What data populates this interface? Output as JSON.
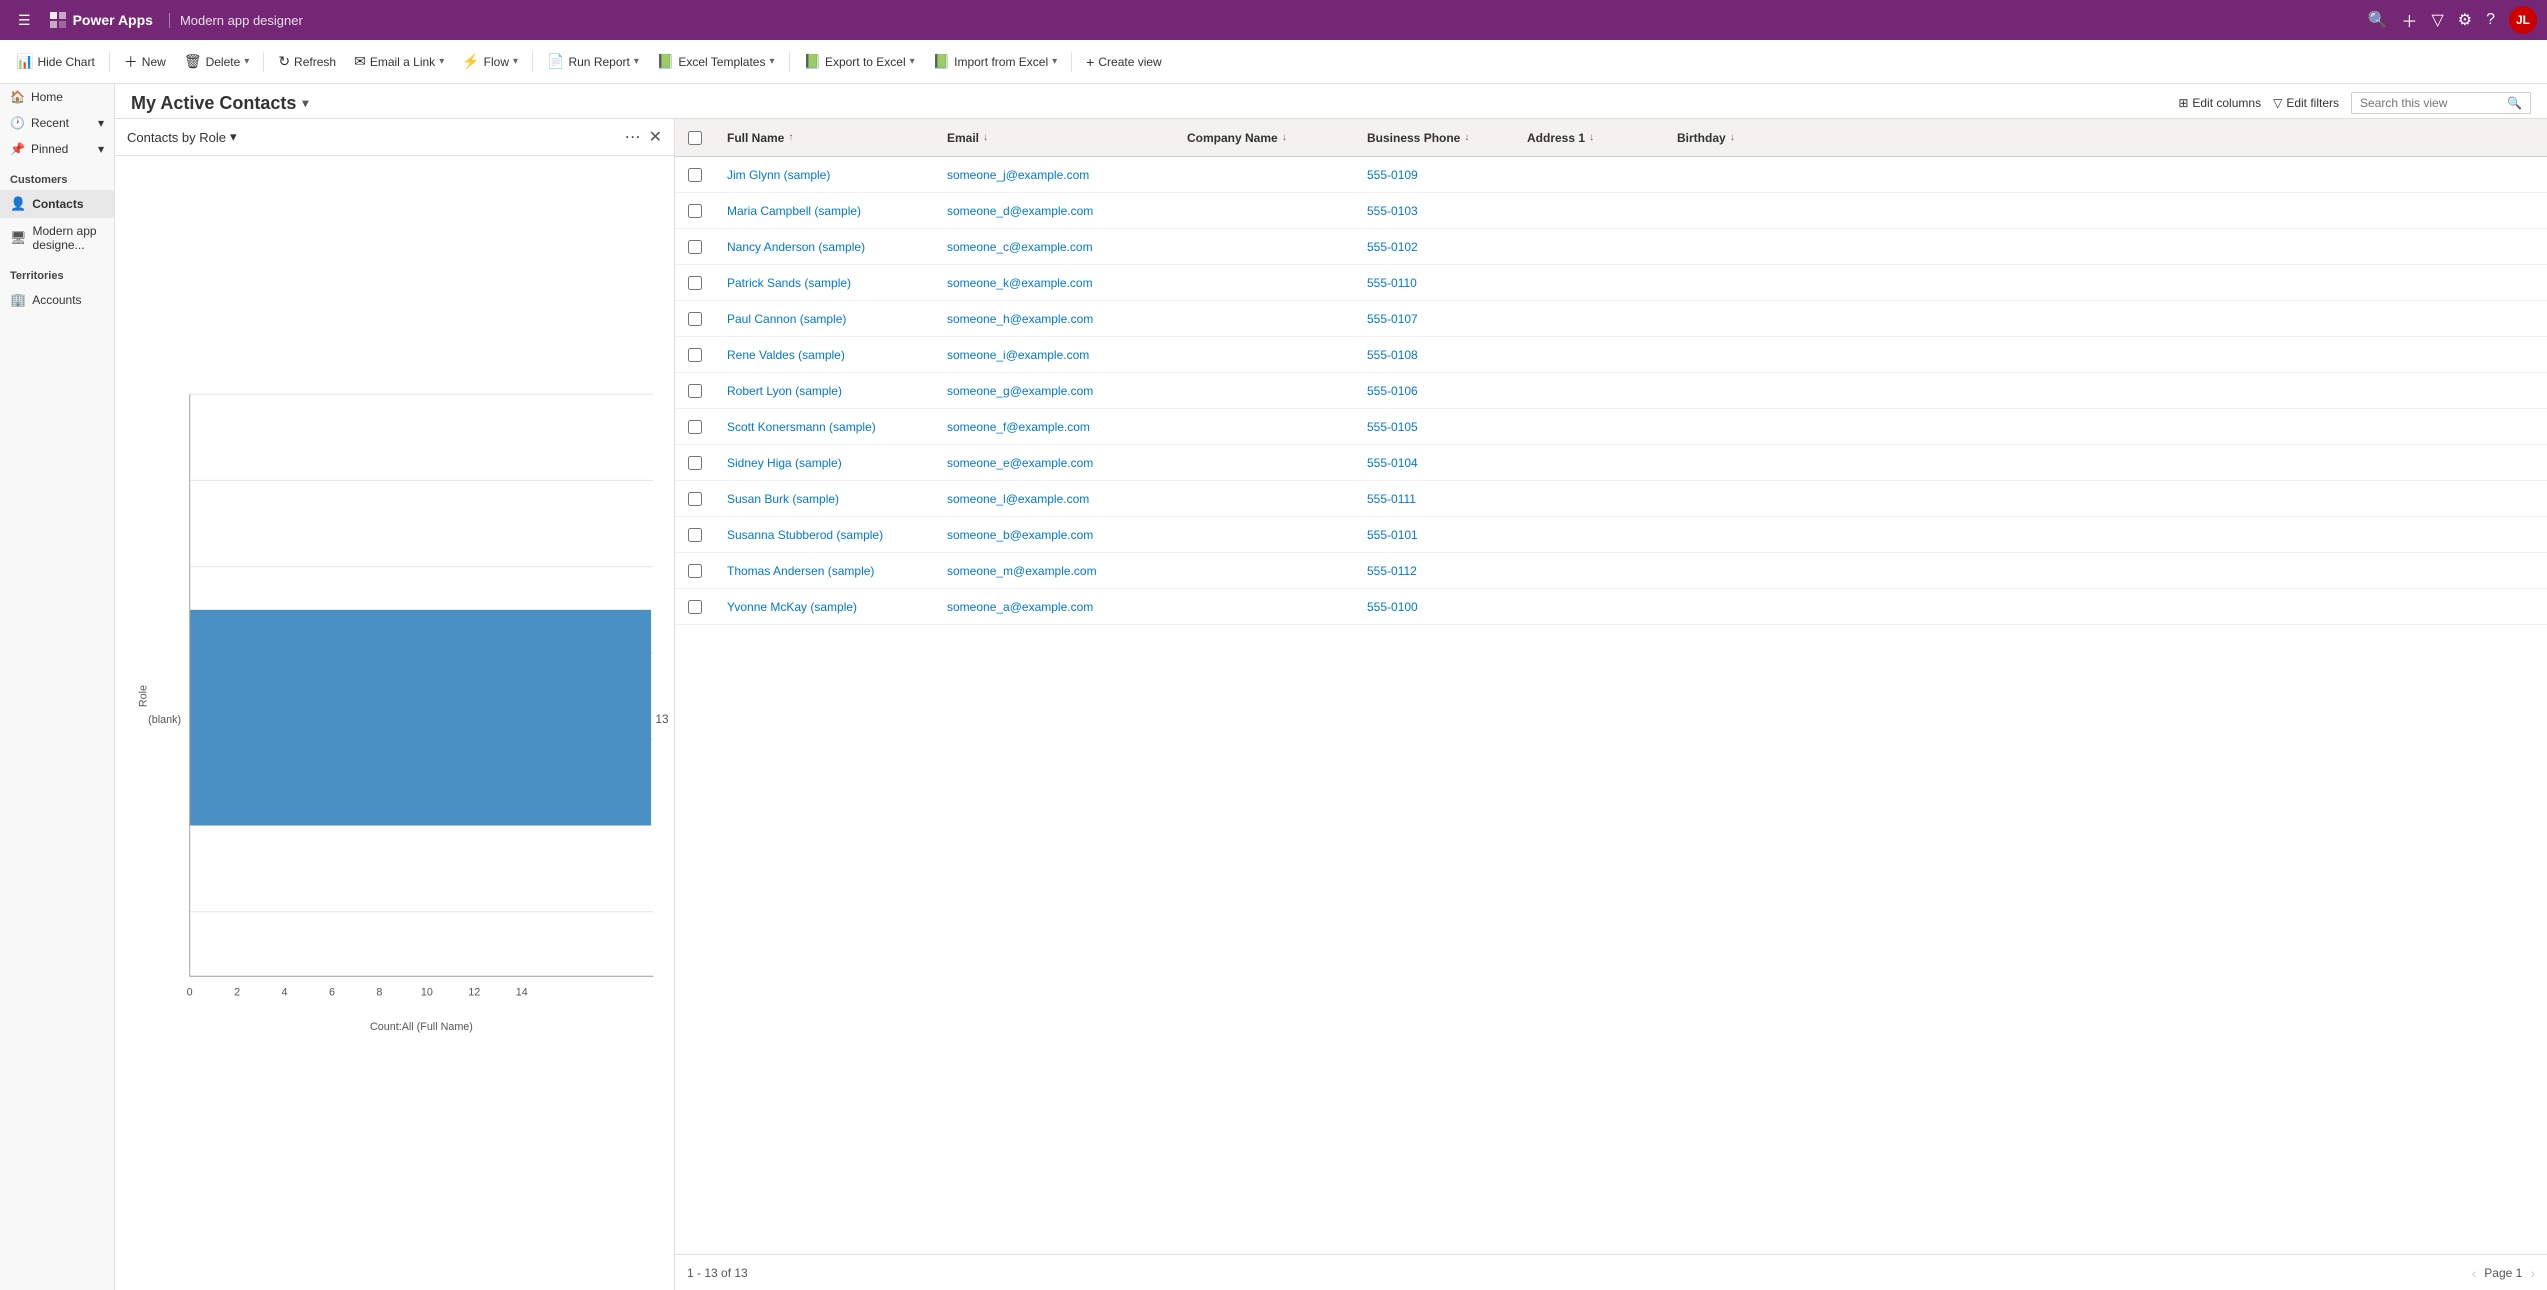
{
  "topbar": {
    "app_name": "Power Apps",
    "page_title": "Modern app designer",
    "avatar_initials": "JL"
  },
  "toolbar": {
    "hide_chart": "Hide Chart",
    "new": "New",
    "delete": "Delete",
    "refresh": "Refresh",
    "email_link": "Email a Link",
    "flow": "Flow",
    "run_report": "Run Report",
    "excel_templates": "Excel Templates",
    "export_excel": "Export to Excel",
    "import_excel": "Import from Excel",
    "create_view": "Create view"
  },
  "view": {
    "title": "My Active Contacts",
    "edit_columns": "Edit columns",
    "edit_filters": "Edit filters",
    "search_placeholder": "Search this view"
  },
  "chart": {
    "title": "Contacts by Role",
    "x_axis_label": "Count:All (Full Name)",
    "y_axis_blank": "(blank)",
    "y_axis_role": "Role",
    "bar_value": "13",
    "bar_count": 13,
    "x_ticks": [
      "0",
      "2",
      "4",
      "6",
      "8",
      "10",
      "12",
      "14"
    ]
  },
  "grid": {
    "columns": [
      {
        "id": "full_name",
        "label": "Full Name",
        "sortable": true,
        "sort_dir": "asc"
      },
      {
        "id": "email",
        "label": "Email",
        "sortable": true
      },
      {
        "id": "company_name",
        "label": "Company Name",
        "sortable": true
      },
      {
        "id": "business_phone",
        "label": "Business Phone",
        "sortable": true
      },
      {
        "id": "address1",
        "label": "Address 1",
        "sortable": true
      },
      {
        "id": "birthday",
        "label": "Birthday",
        "sortable": true
      }
    ],
    "rows": [
      {
        "full_name": "Jim Glynn (sample)",
        "email": "someone_j@example.com",
        "company": "",
        "phone": "555-0109",
        "address": "",
        "birthday": ""
      },
      {
        "full_name": "Maria Campbell (sample)",
        "email": "someone_d@example.com",
        "company": "",
        "phone": "555-0103",
        "address": "",
        "birthday": ""
      },
      {
        "full_name": "Nancy Anderson (sample)",
        "email": "someone_c@example.com",
        "company": "",
        "phone": "555-0102",
        "address": "",
        "birthday": ""
      },
      {
        "full_name": "Patrick Sands (sample)",
        "email": "someone_k@example.com",
        "company": "",
        "phone": "555-0110",
        "address": "",
        "birthday": ""
      },
      {
        "full_name": "Paul Cannon (sample)",
        "email": "someone_h@example.com",
        "company": "",
        "phone": "555-0107",
        "address": "",
        "birthday": ""
      },
      {
        "full_name": "Rene Valdes (sample)",
        "email": "someone_i@example.com",
        "company": "",
        "phone": "555-0108",
        "address": "",
        "birthday": ""
      },
      {
        "full_name": "Robert Lyon (sample)",
        "email": "someone_g@example.com",
        "company": "",
        "phone": "555-0106",
        "address": "",
        "birthday": ""
      },
      {
        "full_name": "Scott Konersmann (sample)",
        "email": "someone_f@example.com",
        "company": "",
        "phone": "555-0105",
        "address": "",
        "birthday": ""
      },
      {
        "full_name": "Sidney Higa (sample)",
        "email": "someone_e@example.com",
        "company": "",
        "phone": "555-0104",
        "address": "",
        "birthday": ""
      },
      {
        "full_name": "Susan Burk (sample)",
        "email": "someone_l@example.com",
        "company": "",
        "phone": "555-0111",
        "address": "",
        "birthday": ""
      },
      {
        "full_name": "Susanna Stubberod (sample)",
        "email": "someone_b@example.com",
        "company": "",
        "phone": "555-0101",
        "address": "",
        "birthday": ""
      },
      {
        "full_name": "Thomas Andersen (sample)",
        "email": "someone_m@example.com",
        "company": "",
        "phone": "555-0112",
        "address": "",
        "birthday": ""
      },
      {
        "full_name": "Yvonne McKay (sample)",
        "email": "someone_a@example.com",
        "company": "",
        "phone": "555-0100",
        "address": "",
        "birthday": ""
      }
    ],
    "footer_count": "1 - 13 of 13",
    "footer_page": "Page 1"
  },
  "sidebar": {
    "home": "Home",
    "recent": "Recent",
    "pinned": "Pinned",
    "customers_section": "Customers",
    "contacts": "Contacts",
    "modern_app_designer": "Modern app designe...",
    "territories_section": "Territories",
    "accounts": "Accounts"
  },
  "colors": {
    "top_bar_bg": "#742774",
    "bar_fill": "#4a90c4",
    "link_color": "#0078d4"
  }
}
